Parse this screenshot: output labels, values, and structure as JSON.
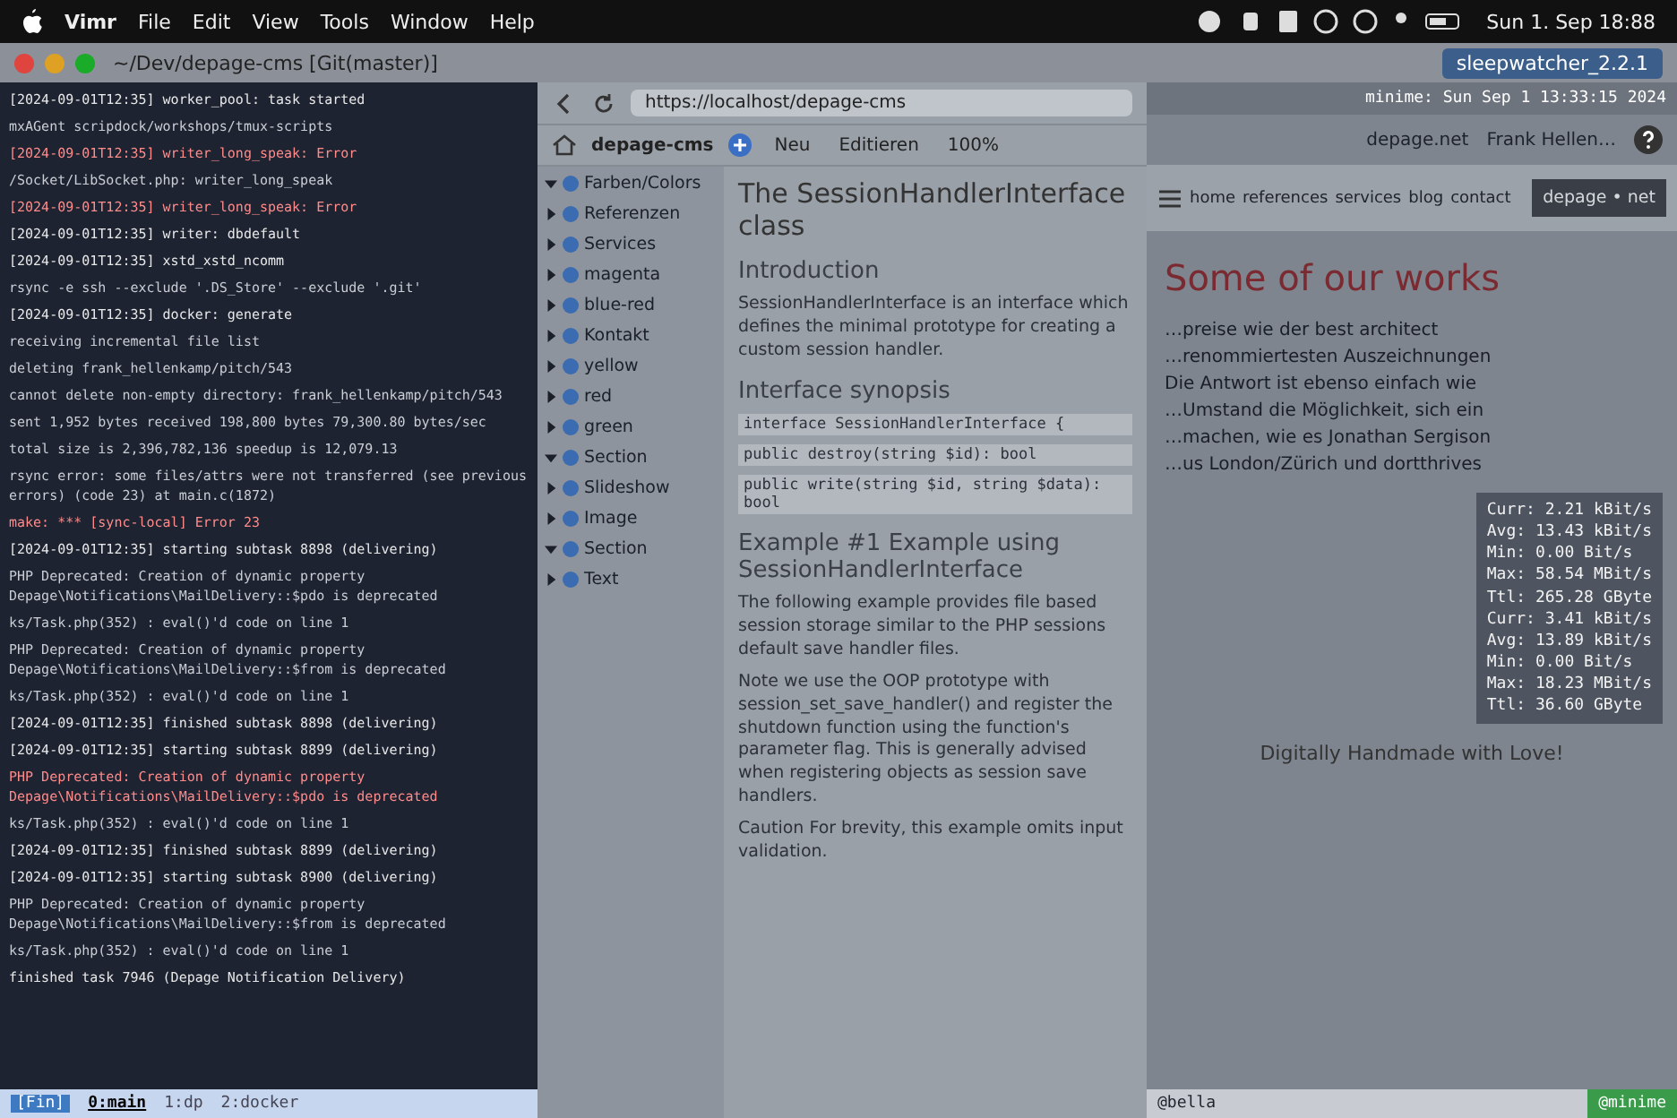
{
  "menubar": {
    "app": "Vimr",
    "items": [
      "File",
      "Edit",
      "View",
      "Tools",
      "Window",
      "Help"
    ],
    "clock": "Sun 1. Sep 18:88"
  },
  "titlebar": {
    "title": "~/Dev/depage-cms [Git(master)]",
    "desktop_item": "sleepwatcher_2.2.1"
  },
  "terminal": {
    "lines": [
      {
        "text": "[2024-09-01T12:35] worker_pool: task started",
        "kind": "log"
      },
      {
        "text": "mxAGent scripdock/workshops/tmux-scripts",
        "kind": "plain"
      },
      {
        "text": "[2024-09-01T12:35] writer_long_speak: Error",
        "kind": "error"
      },
      {
        "text": "/Socket/LibSocket.php: writer_long_speak",
        "kind": "plain"
      },
      {
        "text": "[2024-09-01T12:35] writer_long_speak: Error",
        "kind": "error"
      },
      {
        "text": "[2024-09-01T12:35] writer: dbdefault",
        "kind": "log"
      },
      {
        "text": "[2024-09-01T12:35] xstd_xstd_ncomm",
        "kind": "log"
      },
      {
        "text": "rsync -e ssh --exclude '.DS_Store' --exclude '.git'",
        "kind": "plain"
      },
      {
        "text": "[2024-09-01T12:35] docker: generate",
        "kind": "log"
      },
      {
        "text": "receiving incremental file list",
        "kind": "plain"
      },
      {
        "text": "deleting frank_hellenkamp/pitch/543",
        "kind": "plain"
      },
      {
        "text": "cannot delete non-empty directory: frank_hellenkamp/pitch/543",
        "kind": "plain"
      },
      {
        "text": "sent 1,952 bytes  received 198,800 bytes  79,300.80 bytes/sec",
        "kind": "plain"
      },
      {
        "text": "total size is 2,396,782,136  speedup is 12,079.13",
        "kind": "plain"
      },
      {
        "text": "rsync error: some files/attrs were not transferred (see previous errors) (code 23) at main.c(1872)",
        "kind": "plain"
      },
      {
        "text": "make: *** [sync-local] Error 23",
        "kind": "error"
      },
      {
        "text": "[2024-09-01T12:35] starting subtask 8898 (delivering)",
        "kind": "log"
      },
      {
        "text": "PHP Deprecated: Creation of dynamic property Depage\\Notifications\\MailDelivery::$pdo is deprecated",
        "kind": "plain"
      },
      {
        "text": "ks/Task.php(352) : eval()'d code on line 1",
        "kind": "plain"
      },
      {
        "text": "PHP Deprecated: Creation of dynamic property Depage\\Notifications\\MailDelivery::$from is deprecated",
        "kind": "plain"
      },
      {
        "text": "ks/Task.php(352) : eval()'d code on line 1",
        "kind": "plain"
      },
      {
        "text": "[2024-09-01T12:35] finished subtask 8898 (delivering)",
        "kind": "log"
      },
      {
        "text": "[2024-09-01T12:35] starting subtask 8899 (delivering)",
        "kind": "log"
      },
      {
        "text": "PHP Deprecated: Creation of dynamic property Depage\\Notifications\\MailDelivery::$pdo is deprecated",
        "kind": "error"
      },
      {
        "text": "ks/Task.php(352) : eval()'d code on line 1",
        "kind": "plain"
      },
      {
        "text": "[2024-09-01T12:35] finished subtask 8899 (delivering)",
        "kind": "log"
      },
      {
        "text": "[2024-09-01T12:35] starting subtask 8900 (delivering)",
        "kind": "log"
      },
      {
        "text": "PHP Deprecated: Creation of dynamic property Depage\\Notifications\\MailDelivery::$from is deprecated",
        "kind": "plain"
      },
      {
        "text": "ks/Task.php(352) : eval()'d code on line 1",
        "kind": "plain"
      },
      {
        "text": "finished task 7946 (Depage Notification Delivery)",
        "kind": "log"
      }
    ],
    "status": {
      "session": "[Fin]",
      "windows": [
        {
          "label": "0:main",
          "selected": true
        },
        {
          "label": "1:dp",
          "selected": false
        },
        {
          "label": "2:docker",
          "selected": false
        }
      ]
    }
  },
  "browser": {
    "url": "https://localhost/depage-cms",
    "cms_title": "depage-cms",
    "toolbar": [
      "Neu",
      "Editieren",
      "100%"
    ],
    "tree": [
      {
        "label": "Farben/Colors",
        "expanded": true
      },
      {
        "label": "Referenzen",
        "expanded": false
      },
      {
        "label": "Services",
        "expanded": false
      },
      {
        "label": "magenta",
        "expanded": false
      },
      {
        "label": "blue-red",
        "expanded": false
      },
      {
        "label": "Kontakt",
        "expanded": false
      },
      {
        "label": "yellow",
        "expanded": false
      },
      {
        "label": "red",
        "expanded": false
      },
      {
        "label": "green",
        "expanded": false
      },
      {
        "label": "Section",
        "expanded": true
      },
      {
        "label": "Slideshow",
        "expanded": false
      },
      {
        "label": "Image",
        "expanded": false
      },
      {
        "label": "Section",
        "expanded": true
      },
      {
        "label": "Text",
        "expanded": false
      }
    ],
    "doc": [
      {
        "kind": "title",
        "text": "The SessionHandlerInterface class"
      },
      {
        "kind": "heading",
        "text": "Introduction"
      },
      {
        "kind": "para",
        "text": "SessionHandlerInterface is an interface which defines the minimal prototype for creating a custom session handler."
      },
      {
        "kind": "heading",
        "text": "Interface synopsis"
      },
      {
        "kind": "code",
        "text": "interface SessionHandlerInterface {"
      },
      {
        "kind": "code",
        "text": "public destroy(string $id): bool"
      },
      {
        "kind": "code",
        "text": "public write(string $id, string $data): bool"
      },
      {
        "kind": "heading",
        "text": "Example #1 Example using SessionHandlerInterface"
      },
      {
        "kind": "para",
        "text": "The following example provides file based session storage similar to the PHP sessions default save handler files."
      },
      {
        "kind": "para",
        "text": "Note we use the OOP prototype with session_set_save_handler() and register the shutdown function using the function's parameter flag. This is generally advised when registering objects as session save handlers."
      },
      {
        "kind": "para",
        "text": "Caution For brevity, this example omits input validation."
      }
    ]
  },
  "site": {
    "host_clock": "minime: Sun Sep  1 13:33:15 2024",
    "domain": "depage.net",
    "user": "Frank Hellen…",
    "nav": [
      "home",
      "references",
      "services",
      "blog",
      "contact"
    ],
    "logo": "depage • net",
    "headline": "Some of our works",
    "teaser": [
      "…preise wie der best architect",
      "…renommiertesten Auszeichnungen",
      "Die Antwort ist ebenso einfach wie",
      "…Umstand die Möglichkeit, sich ein",
      "…machen, wie es Jonathan Sergison",
      "…us London/Zürich und dortthrives"
    ],
    "footer": "Digitally Handmade with Love!",
    "stats": [
      "Curr: 2.21 kBit/s",
      "Avg: 13.43 kBit/s",
      "Min: 0.00 Bit/s",
      "Max: 58.54 MBit/s",
      "Ttl: 265.28 GByte",
      "Curr: 3.41 kBit/s",
      "Avg: 13.89 kBit/s",
      "Min: 0.00 Bit/s",
      "Max: 18.23 MBit/s",
      "Ttl: 36.60 GByte"
    ],
    "tmux_host": "@minime",
    "tmux_user": "@bella"
  }
}
